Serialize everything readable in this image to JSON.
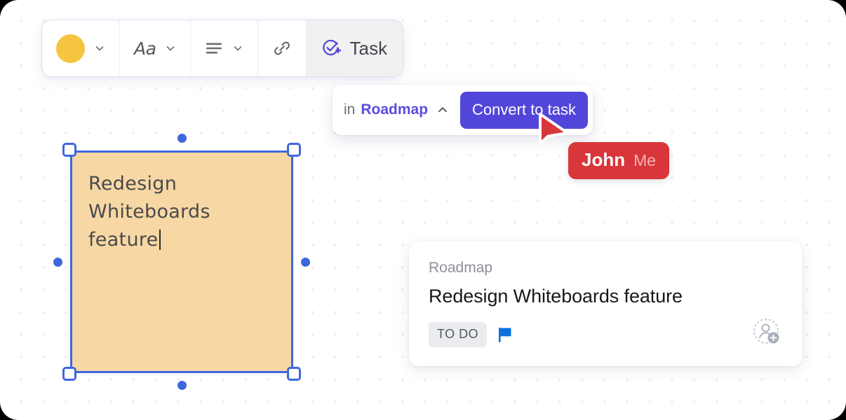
{
  "canvas": {
    "background_color": "#ffffff",
    "dot_color": "#e9e9ed"
  },
  "toolbar": {
    "color_swatch": {
      "name": "fill-color",
      "value": "#f6c53f",
      "chevron": "chevron-down-icon"
    },
    "font": {
      "glyph": "Aa",
      "chevron": "chevron-down-icon"
    },
    "align": {
      "icon": "text-align-icon",
      "chevron": "chevron-down-icon"
    },
    "link": {
      "icon": "link-icon"
    },
    "task": {
      "icon": "task-check-plus-icon",
      "label": "Task",
      "active": true,
      "accent": "#5146d9"
    }
  },
  "convert_popover": {
    "prefix": "in",
    "space_name": "Roadmap",
    "space_color": "#5b4ddb",
    "chevron": "chevron-up-icon",
    "button_label": "Convert to task",
    "button_color": "#5146d9"
  },
  "collaborator": {
    "cursor_color": "#d8363a",
    "user_name": "John",
    "self_label": "Me"
  },
  "sticky_note": {
    "text": "Redesign\nWhiteboards\nfeature",
    "fill_color": "#f7d7a4",
    "selection_color": "#3f67dd",
    "editing": true,
    "handles": [
      "handle-top-left",
      "handle-top-right",
      "handle-bottom-left",
      "handle-bottom-right",
      "handle-top-mid",
      "handle-bottom-mid",
      "handle-left-mid",
      "handle-right-mid"
    ]
  },
  "task_card": {
    "space": "Roadmap",
    "title": "Redesign Whiteboards feature",
    "status": "TO DO",
    "status_bg": "#ebecf0",
    "priority_flag": {
      "icon": "flag-icon",
      "color": "#0b6fde"
    },
    "assignee": {
      "icon": "add-assignee-icon",
      "value": ""
    }
  }
}
